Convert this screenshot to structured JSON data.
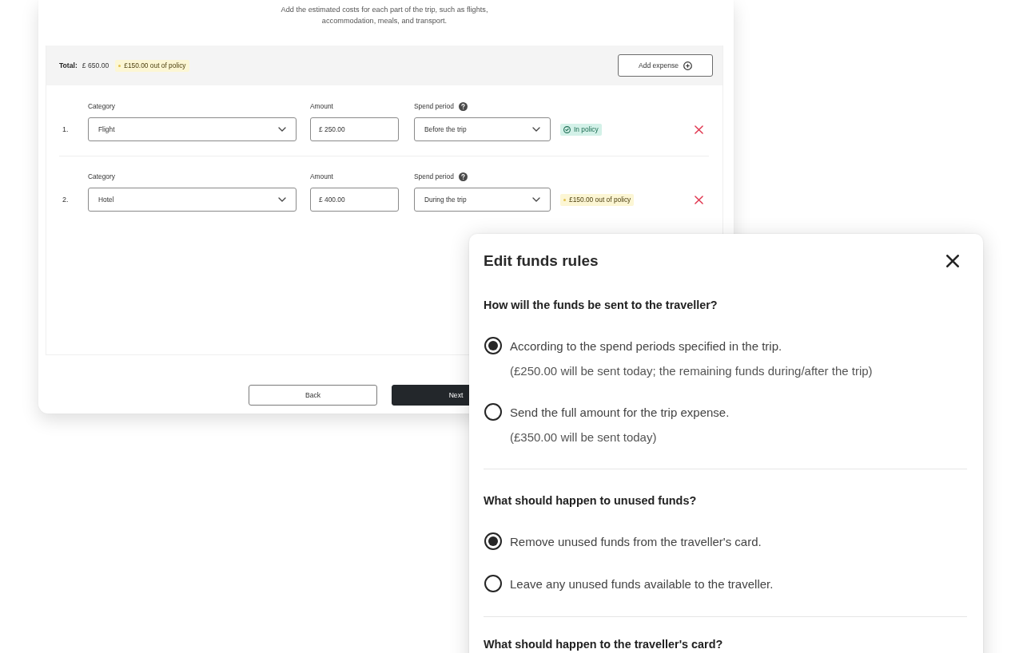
{
  "expenses_page": {
    "description": "Add the estimated costs for each part of the trip, such as flights, accommodation, meals, and transport.",
    "summary": {
      "total_label": "Total:",
      "total_value": "£ 650.00",
      "policy_badge": {
        "kind": "out_of_policy",
        "text": "£150.00 out of policy"
      }
    },
    "add_button": "Add expense",
    "expenses": [
      {
        "number": "1.",
        "category_label": "Category",
        "category": "Flight",
        "amount_label": "Amount",
        "amount": "£ 250.00",
        "period_label": "Spend period",
        "period": "Before the trip",
        "status": {
          "kind": "in_policy",
          "text": "In policy"
        }
      },
      {
        "number": "2.",
        "category_label": "Category",
        "category": "Hotel",
        "amount_label": "Amount",
        "amount": "£ 400.00",
        "period_label": "Spend period",
        "period": "During the trip",
        "status": {
          "kind": "out_of_policy",
          "text": "£150.00 out of policy"
        }
      }
    ],
    "buttons": [
      {
        "label": "Back",
        "kind": "secondary"
      },
      {
        "label": "Next",
        "kind": "primary"
      }
    ]
  },
  "dialog": {
    "title": "Edit funds rules",
    "sections": [
      {
        "question": "How will the funds be sent to the traveller?",
        "options": [
          {
            "label": "According to the spend periods specified in the trip.",
            "note": "(£250.00 will be sent today; the remaining funds during/after the trip)",
            "selected": true
          },
          {
            "label": "Send the full amount for the trip expense.",
            "note": "(£350.00 will be sent today)",
            "selected": false
          }
        ]
      },
      {
        "question": "What should happen to unused funds?",
        "options": [
          {
            "label": "Remove unused funds from the traveller's card.",
            "selected": true
          },
          {
            "label": "Leave any unused funds available to the traveller.",
            "selected": false
          }
        ]
      },
      {
        "question": "What should happen to the traveller's card?"
      }
    ]
  }
}
